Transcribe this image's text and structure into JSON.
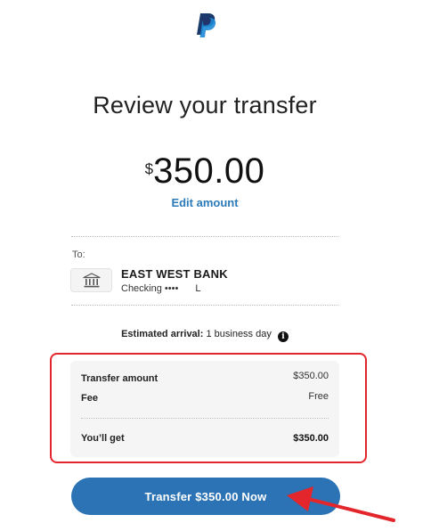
{
  "page": {
    "title": "Review your transfer"
  },
  "amount": {
    "currency_symbol": "$",
    "value": "350.00",
    "edit_label": "Edit amount"
  },
  "recipient": {
    "to_label": "To:",
    "bank_name": "EAST WEST BANK",
    "account_type": "Checking",
    "account_mask": "••••",
    "account_suffix": "L",
    "icon": "bank-icon"
  },
  "arrival": {
    "label": "Estimated arrival:",
    "value": "1 business day",
    "icon": "info-icon"
  },
  "summary": {
    "rows": [
      {
        "label": "Transfer amount",
        "value": "$350.00"
      },
      {
        "label": "Fee",
        "value": "Free"
      },
      {
        "label": "You’ll get",
        "value": "$350.00"
      }
    ]
  },
  "actions": {
    "transfer_button": "Transfer $350.00 Now"
  },
  "colors": {
    "accent": "#2b73b5",
    "link": "#2c7ab8",
    "annotation": "#e3262b"
  }
}
